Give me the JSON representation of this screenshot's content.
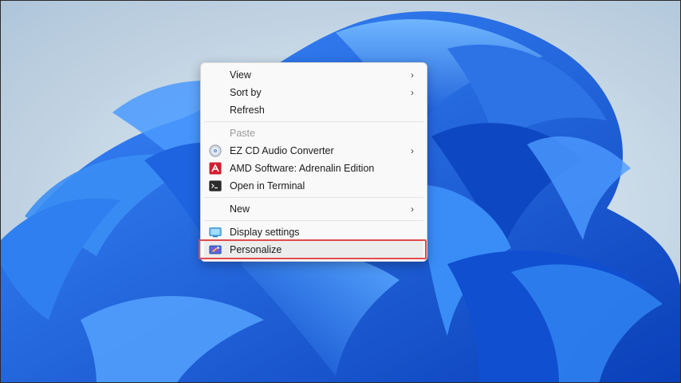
{
  "context_menu": {
    "items": [
      {
        "label": "View",
        "submenu": true
      },
      {
        "label": "Sort by",
        "submenu": true
      },
      {
        "label": "Refresh"
      },
      {
        "label": "Paste",
        "disabled": true
      },
      {
        "label": "EZ CD Audio Converter",
        "icon": "cd-icon",
        "submenu": true
      },
      {
        "label": "AMD Software: Adrenalin Edition",
        "icon": "amd-icon"
      },
      {
        "label": "Open in Terminal",
        "icon": "terminal-icon"
      },
      {
        "label": "New",
        "submenu": true
      },
      {
        "label": "Display settings",
        "icon": "display-icon"
      },
      {
        "label": "Personalize",
        "icon": "personalize-icon",
        "highlighted": true
      }
    ],
    "submenu_glyph": "›"
  },
  "colors": {
    "highlight_border": "#e24b4b",
    "wallpaper_blue": "#1a5fd8",
    "menu_background": "#f9f9f9"
  }
}
